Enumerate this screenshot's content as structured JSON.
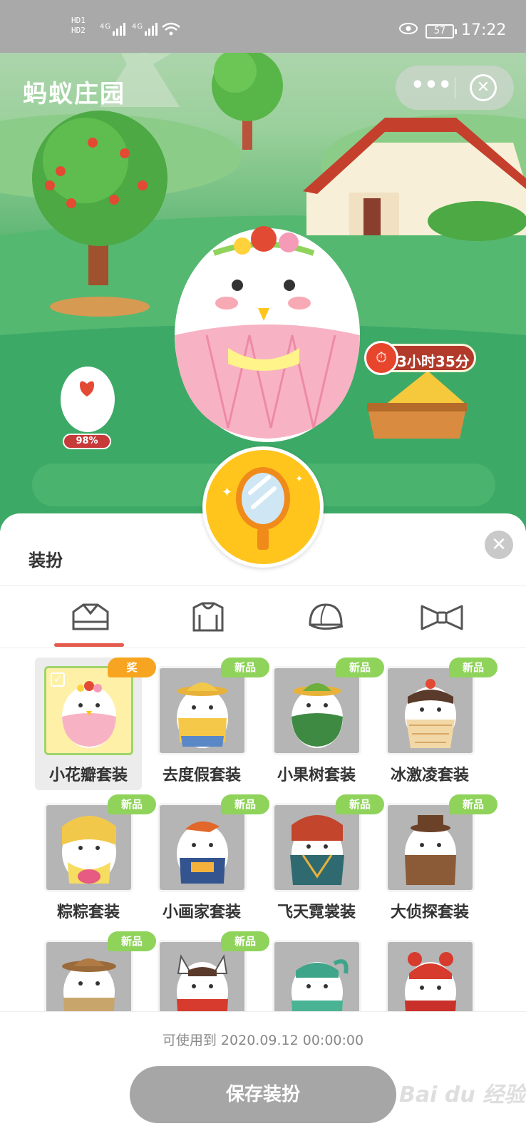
{
  "status_bar": {
    "sim": "HD1\nHD2",
    "network": "4G 4G",
    "battery": "57",
    "time": "17:22"
  },
  "header": {
    "app_title": "蚂蚁庄园",
    "more_label": "•••",
    "close_label": "✕"
  },
  "scene": {
    "timer": "3小时35分",
    "egg_progress": "98%"
  },
  "sheet": {
    "title": "装扮",
    "close_label": "✕",
    "tabs": [
      {
        "icon": "clothes-icon"
      },
      {
        "icon": "hoodie-icon"
      },
      {
        "icon": "hat-icon"
      },
      {
        "icon": "bowtie-icon"
      }
    ],
    "items": [
      {
        "name": "小花瓣套装",
        "badge": "奖",
        "selected": true
      },
      {
        "name": "去度假套装",
        "badge": "新品"
      },
      {
        "name": "小果树套装",
        "badge": "新品"
      },
      {
        "name": "冰激凌套装",
        "badge": "新品"
      },
      {
        "name": "粽粽套装",
        "badge": "新品"
      },
      {
        "name": "小画家套装",
        "badge": "新品"
      },
      {
        "name": "飞天霓裳装",
        "badge": "新品"
      },
      {
        "name": "大侦探套装",
        "badge": "新品"
      },
      {
        "name": "",
        "badge": "新品"
      },
      {
        "name": "",
        "badge": "新品"
      },
      {
        "name": "",
        "badge": ""
      },
      {
        "name": "",
        "badge": ""
      }
    ],
    "valid_until": "可使用到  2020.09.12  00:00:00",
    "save_label": "保存装扮"
  },
  "watermark": "Bai du 经验",
  "colors": {
    "accent": "#e45a4c",
    "badge_new": "#8fd35b",
    "badge_award": "#f7a521",
    "mirror": "#ffc51c"
  }
}
